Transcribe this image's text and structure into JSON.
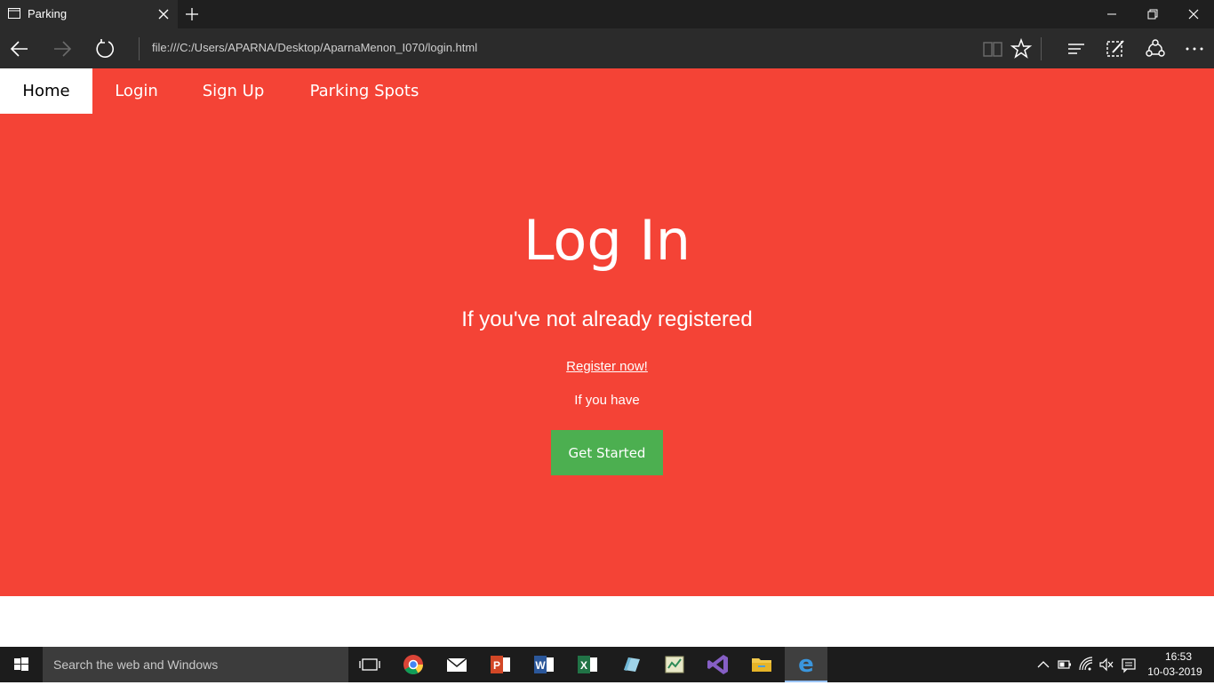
{
  "browser": {
    "tab_title": "Parking",
    "url": "file:///C:/Users/APARNA/Desktop/AparnaMenon_I070/login.html"
  },
  "nav": {
    "items": [
      {
        "label": "Home",
        "active": true
      },
      {
        "label": "Login"
      },
      {
        "label": "Sign Up"
      },
      {
        "label": "Parking Spots"
      }
    ]
  },
  "hero": {
    "title": "Log In",
    "subtitle": "If you've not already registered",
    "register_link": "Register now!",
    "have_text": "If you have",
    "cta_label": "Get Started"
  },
  "taskbar": {
    "search_placeholder": "Search the web and Windows",
    "time": "16:53",
    "date": "10-03-2019"
  },
  "colors": {
    "accent": "#f44336",
    "button": "#4caf50"
  }
}
